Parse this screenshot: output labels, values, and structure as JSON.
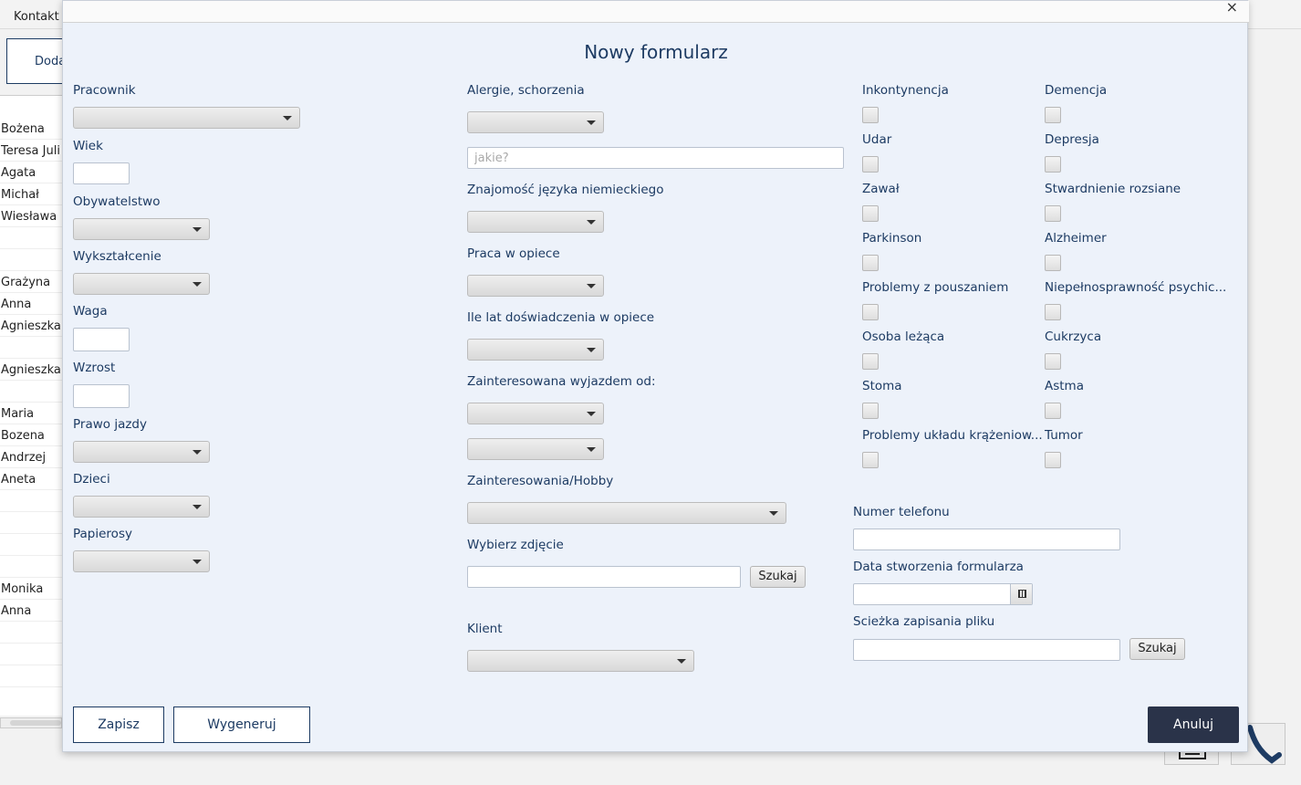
{
  "background": {
    "menu": {
      "kontakt": "Kontakt"
    },
    "add_button": "Doda",
    "names": [
      "Bożena",
      "Teresa Juli",
      "Agata",
      "Michał",
      "Wiesława",
      "",
      "",
      "Grażyna",
      "Anna",
      "Agnieszka",
      "",
      "Agnieszka",
      "",
      "Maria",
      "Bozena",
      "Andrzej",
      "Aneta",
      "",
      "",
      "",
      "",
      "Monika",
      "Anna",
      "",
      "",
      ""
    ]
  },
  "dialog": {
    "close_icon": "×",
    "title": "Nowy formularz",
    "left": {
      "pracownik": "Pracownik",
      "wiek": "Wiek",
      "obywatelstwo": "Obywatelstwo",
      "wyksztalcenie": "Wykształcenie",
      "waga": "Waga",
      "wzrost": "Wzrost",
      "prawo_jazdy": "Prawo jazdy",
      "dzieci": "Dzieci",
      "papierosy": "Papierosy"
    },
    "middle": {
      "alergie": "Alergie, schorzenia",
      "jakie_placeholder": "jakie?",
      "jezyk": "Znajomość języka niemieckiego",
      "praca": "Praca w opiece",
      "ile_lat": "Ile lat doświadczenia w opiece",
      "wyjazd": "Zainteresowana wyjazdem od:",
      "hobby": "Zainteresowania/Hobby",
      "zdjecie": "Wybierz zdjęcie",
      "szukaj": "Szukaj",
      "klient": "Klient"
    },
    "conditions": {
      "col1": [
        "Inkontynencja",
        "Udar",
        "Zawał",
        "Parkinson",
        "Problemy z pouszaniem",
        "Osoba leżąca",
        "Stoma",
        "Problemy układu krążeniow..."
      ],
      "col2": [
        "Demencja",
        "Depresja",
        "Stwardnienie rozsiane",
        "Alzheimer",
        "Niepełnosprawność psychic...",
        "Cukrzyca",
        "Astma",
        "Tumor"
      ]
    },
    "right": {
      "telefon": "Numer telefonu",
      "data": "Data stworzenia formularza",
      "sciezka": "Scieżka zapisania pliku",
      "szukaj": "Szukaj"
    },
    "buttons": {
      "zapisz": "Zapisz",
      "wygeneruj": "Wygeneruj",
      "anuluj": "Anuluj"
    }
  }
}
